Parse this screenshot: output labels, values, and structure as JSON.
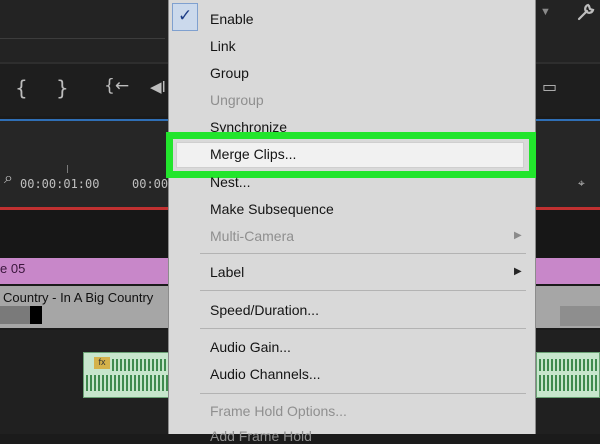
{
  "ruler": {
    "timecode_left": "00:00:01:00",
    "timecode_right": "00:00"
  },
  "tracks": {
    "pink_clip_label": "e 05",
    "video_clip_label": "Country - In A Big Country"
  },
  "transport": {
    "in_point_icon": "in-point-icon",
    "out_point_icon": "out-point-icon",
    "go_to_in_icon": "go-to-in-icon",
    "step_back_icon": "step-back-icon"
  },
  "menu": {
    "enable": "Enable",
    "link": "Link",
    "group": "Group",
    "ungroup": "Ungroup",
    "synchronize": "Synchronize",
    "merge_clips": "Merge Clips...",
    "nest": "Nest...",
    "make_subsequence": "Make Subsequence",
    "multi_camera": "Multi-Camera",
    "label": "Label",
    "speed_duration": "Speed/Duration...",
    "audio_gain": "Audio Gain...",
    "audio_channels": "Audio Channels...",
    "frame_hold_options": "Frame Hold Options...",
    "add_frame_hold": "Add Frame Hold"
  },
  "colors": {
    "highlight": "#22e52c",
    "pink_clip": "#c887c9",
    "playhead_line": "#c03030",
    "audio_clip": "#c7e6cc",
    "menu_bg": "#d9d9d9"
  }
}
